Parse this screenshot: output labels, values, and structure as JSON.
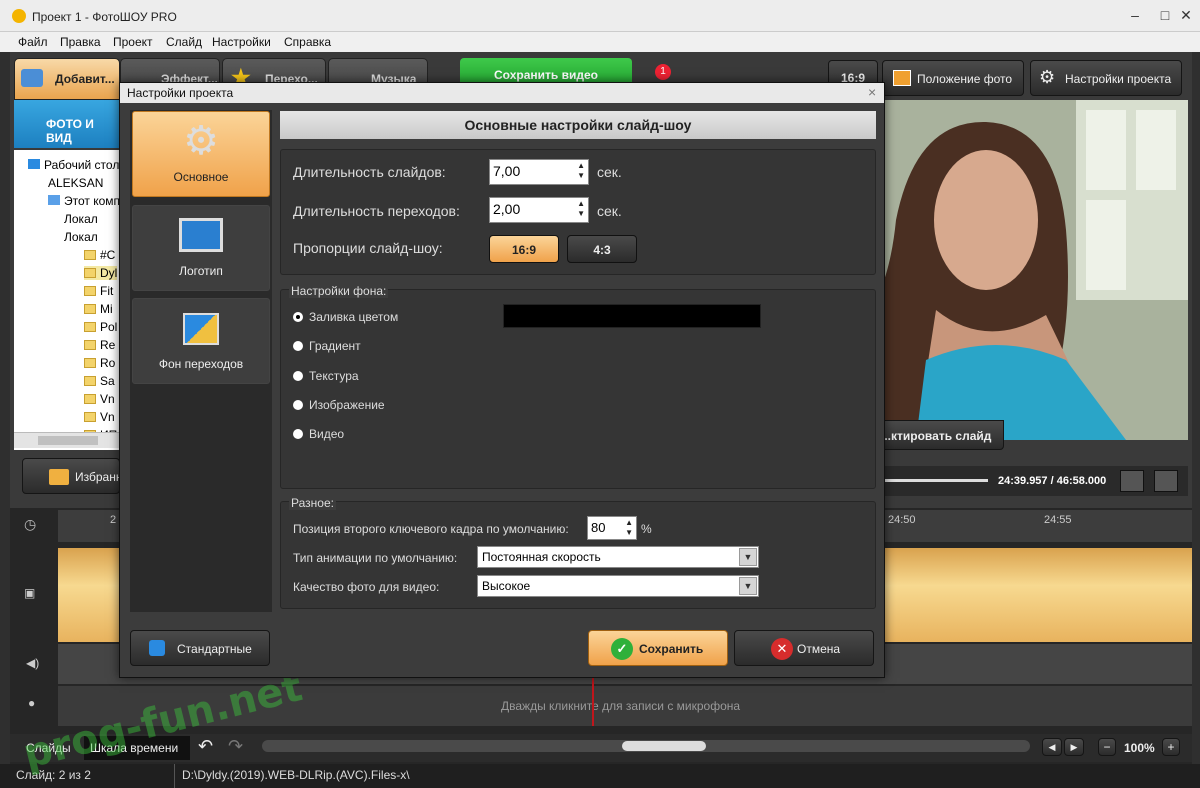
{
  "window": {
    "title": "Проект 1 - ФотоШОУ PRO",
    "minimize": "–",
    "maximize": "□",
    "close": "✕"
  },
  "menu": [
    "Файл",
    "Правка",
    "Проект",
    "Слайд",
    "Настройки",
    "Справка"
  ],
  "toolbar": {
    "tabs": [
      "Добавит...",
      "Эффект...",
      "Перехо...",
      "Музыка"
    ],
    "save_video": "Сохранить видео",
    "notification_count": "1",
    "ratio_badge": "16:9",
    "photo_position": "Положение фото",
    "project_settings": "Настройки проекта"
  },
  "left_panel": {
    "header": "ФОТО И ВИД",
    "tree": [
      "Рабочий стол",
      "ALEKSAN",
      "Этот компь",
      "Локал",
      "Локал",
      "#C",
      "Dyl",
      "Fit",
      "Mi",
      "Pol",
      "Re",
      "Ro",
      "Sa",
      "Vn",
      "Vn",
      "ИП"
    ],
    "favorites": "Избранн"
  },
  "preview": {
    "edit_slide": "...ктировать слайд",
    "time": "24:39.957 / 46:58.000"
  },
  "timeline": {
    "ticks": [
      "2",
      "24:50",
      "24:55"
    ],
    "mic_hint": "Дважды кликните для записи с микрофона",
    "tab_slides": "Слайды",
    "tab_timeline": "Шкала времени",
    "zoom": "100%",
    "zoom_minus": "−",
    "zoom_plus": "+"
  },
  "status": {
    "slide": "Слайд: 2 из 2",
    "path": "D:\\Dyldy.(2019).WEB-DLRip.(AVC).Files-x\\"
  },
  "watermark": "prog-fun.net",
  "dialog": {
    "title": "Настройки проекта",
    "close": "×",
    "nav": [
      "Основное",
      "Логотип",
      "Фон переходов"
    ],
    "header": "Основные настройки слайд-шоу",
    "slide_duration_label": "Длительность слайдов:",
    "slide_duration": "7,00",
    "transition_duration_label": "Длительность переходов:",
    "transition_duration": "2,00",
    "unit": "сек.",
    "ratio_label": "Пропорции слайд-шоу:",
    "ratio_options": [
      "16:9",
      "4:3"
    ],
    "background_group": "Настройки фона:",
    "background_options": [
      "Заливка цветом",
      "Градиент",
      "Текстура",
      "Изображение",
      "Видео"
    ],
    "background_color": "#000000",
    "misc_group": "Разное:",
    "keyframe_label": "Позиция второго ключевого кадра по умолчанию:",
    "keyframe_value": "80",
    "percent": "%",
    "animation_label": "Тип анимации по умолчанию:",
    "animation_value": "Постоянная скорость",
    "quality_label": "Качество фото для видео:",
    "quality_value": "Высокое",
    "defaults_button": "Стандартные",
    "save_button": "Сохранить",
    "cancel_button": "Отмена"
  }
}
